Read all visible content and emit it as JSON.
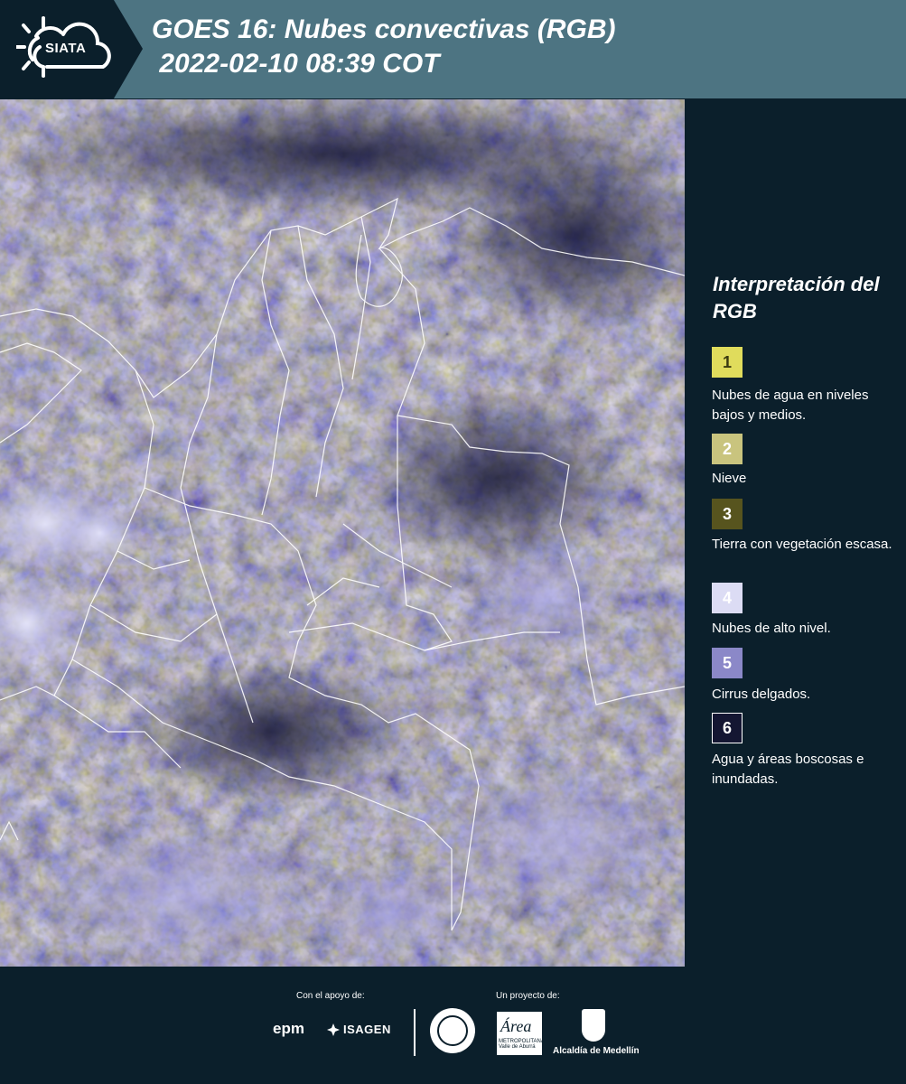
{
  "header": {
    "logo_text": "SIATA",
    "title": "GOES 16: Nubes convectivas (RGB)\n 2022-02-10 08:39 COT"
  },
  "map": {
    "description_icon": "satellite-rgb-image"
  },
  "legend": {
    "title": "Interpretación del RGB",
    "items": [
      {
        "number": "1",
        "label": "Nubes de agua en niveles bajos y medios.",
        "color": "#e0dc5c",
        "text_color": "#3a3a10"
      },
      {
        "number": "2",
        "label": "Nieve",
        "color": "#c9c47e",
        "text_color": "#ffffff"
      },
      {
        "number": "3",
        "label": "Tierra con vegetación escasa.",
        "color": "#57541e",
        "text_color": "#ffffff"
      },
      {
        "number": "4",
        "label": "Nubes de alto nivel.",
        "color": "#dcdcf4",
        "text_color": "#ffffff"
      },
      {
        "number": "5",
        "label": "Cirrus delgados.",
        "color": "#8b88c8",
        "text_color": "#ffffff"
      },
      {
        "number": "6",
        "label": "Agua y áreas boscosas e inundadas.",
        "color": "#141632",
        "text_color": "#ffffff",
        "border": "#ffffff"
      }
    ]
  },
  "footer": {
    "support_label": "Con el apoyo de:",
    "project_label": "Un proyecto de:",
    "sponsor_1": "epm",
    "sponsor_2": "ISAGEN",
    "partner_area": "Área",
    "partner_area_sub": "METROPOLITANA Valle de Aburrá",
    "partner_alcaldia": "Alcaldía de Medellín"
  }
}
